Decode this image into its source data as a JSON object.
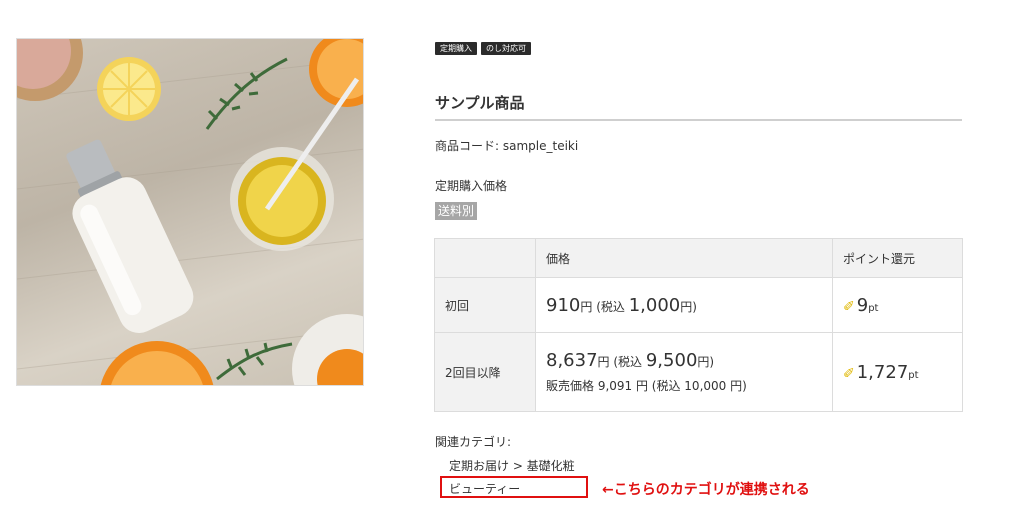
{
  "badges": [
    "定期購入",
    "のし対応可"
  ],
  "product": {
    "name": "サンプル商品",
    "code_label": "商品コード:",
    "code_value": "sample_teiki",
    "price_heading": "定期購入価格",
    "shipping_tag": "送料別"
  },
  "table": {
    "headers": [
      "",
      "価格",
      "ポイント還元"
    ],
    "rows": [
      {
        "label": "初回",
        "price": "910",
        "yen": "円",
        "tax_open": " (税込 ",
        "tax_price": "1,000",
        "tax_close": "円)",
        "points": "9",
        "pt_unit": "pt"
      },
      {
        "label": "2回目以降",
        "price": "8,637",
        "yen": "円",
        "tax_open": " (税込 ",
        "tax_price": "9,500",
        "tax_close": "円)",
        "sale_note": "販売価格 9,091 円 (税込 10,000 円)",
        "points": "1,727",
        "pt_unit": "pt"
      }
    ]
  },
  "related": {
    "label": "関連カテゴリ:",
    "categories": [
      "定期お届け > 基礎化粧",
      "ビューティー"
    ]
  },
  "annotation": "←こちらのカテゴリが連携される",
  "icons": {
    "points": "pencil-icon"
  },
  "colors": {
    "annotation": "#e01010",
    "badge_bg": "#2b2b2b",
    "shipping_tag_bg": "#a6a6a6"
  }
}
